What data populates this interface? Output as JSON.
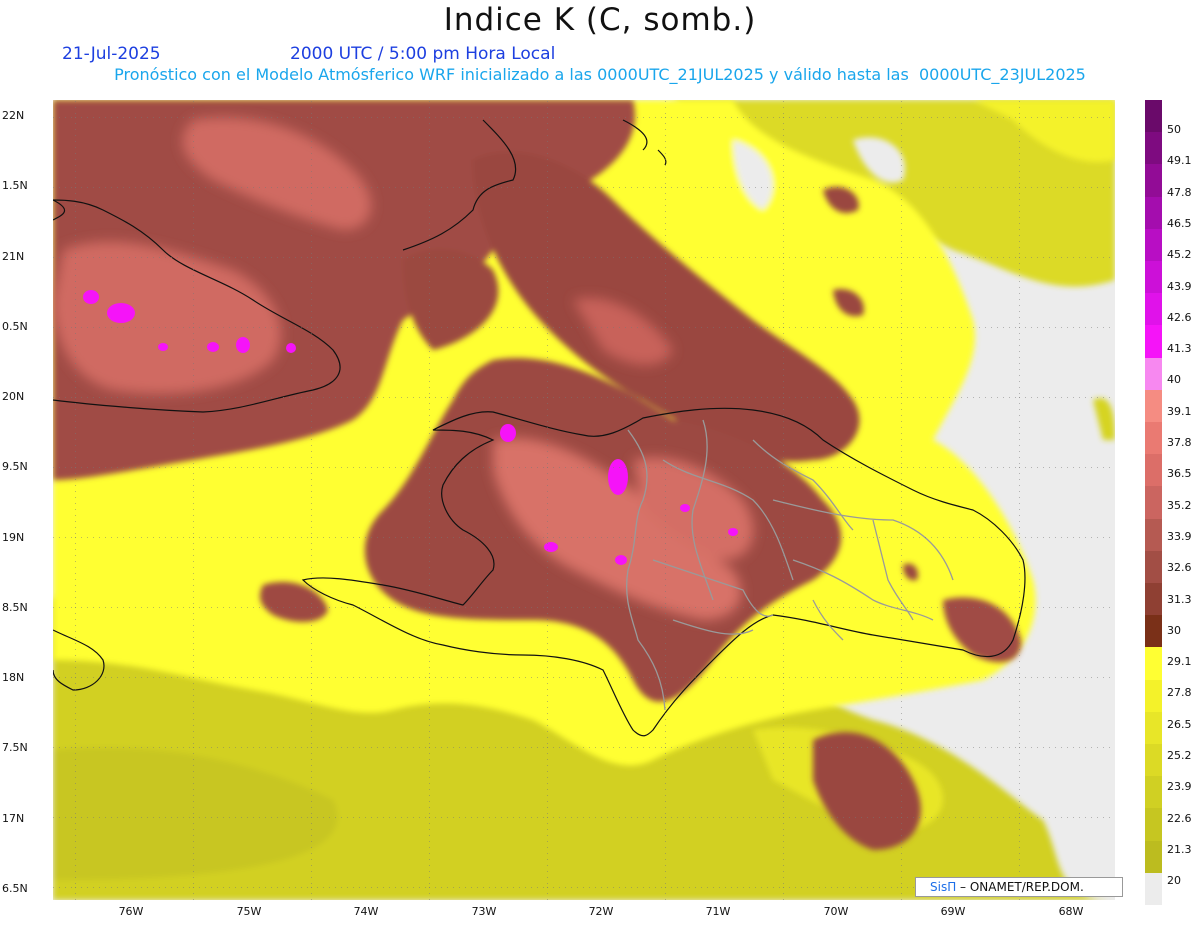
{
  "title": "Indice K (C, somb.)",
  "date": "21-Jul-2025",
  "valid_time": "2000 UTC / 5:00 pm Hora Local",
  "subtitle": "Pronóstico con el Modelo Atmósferico WRF inicializado a las 0000UTC_21JUL2025 y válido hasta las  0000UTC_23JUL2025",
  "lat_labels": [
    "22N",
    "1.5N",
    "21N",
    "0.5N",
    "20N",
    "9.5N",
    "19N",
    "8.5N",
    "18N",
    "7.5N",
    "17N",
    "6.5N"
  ],
  "lon_labels": [
    "76W",
    "75W",
    "74W",
    "73W",
    "72W",
    "71W",
    "70W",
    "69W",
    "68W"
  ],
  "colorbar": {
    "labels": [
      "50",
      "49.1",
      "47.8",
      "46.5",
      "45.2",
      "43.9",
      "42.6",
      "41.3",
      "40",
      "39.1",
      "37.8",
      "36.5",
      "35.2",
      "33.9",
      "32.6",
      "31.3",
      "30",
      "29.1",
      "27.8",
      "26.5",
      "25.2",
      "23.9",
      "22.6",
      "21.3",
      "20"
    ],
    "colors": [
      "#6a0a6a",
      "#7e0b80",
      "#920c96",
      "#a40dae",
      "#b80ec4",
      "#cc10d8",
      "#e012ea",
      "#f514f8",
      "#f788f0",
      "#f58c82",
      "#ea7a72",
      "#dc6e68",
      "#cb6560",
      "#b55a52",
      "#a24e45",
      "#8f4033",
      "#7a3018",
      "#ffff33",
      "#f4f22a",
      "#e8e628",
      "#dcda25",
      "#d0d023",
      "#c6c621",
      "#bcbc1f",
      "#ececec"
    ]
  },
  "credit": {
    "brand": "SisΠ",
    "text": " – ONAMET/REP.DOM."
  }
}
